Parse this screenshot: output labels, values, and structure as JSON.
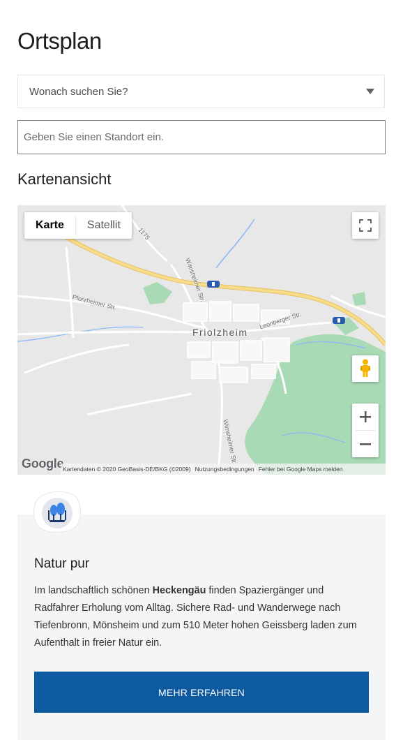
{
  "page": {
    "title": "Ortsplan"
  },
  "filter": {
    "select_value": "Wonach suchen Sie?",
    "location_placeholder": "Geben Sie einen Standort ein."
  },
  "map_section": {
    "title": "Kartenansicht"
  },
  "map": {
    "type_options": [
      "Karte",
      "Satellit"
    ],
    "active_type": "Karte",
    "town": "Friolzheim",
    "street_labels": [
      "Pforzheimer Str.",
      "Wimsheimer Str.",
      "Leonberger Str.",
      "Wimsheimer Str.",
      "1175"
    ],
    "google_logo": "Google",
    "attribution": "Kartendaten © 2020 GeoBasis-DE/BKG (©2009)",
    "terms_link": "Nutzungsbedingungen",
    "report_link": "Fehler bei Google Maps melden",
    "icons": {
      "fullscreen": "fullscreen-icon",
      "pegman": "pegman-icon",
      "zoom_in": "plus-icon",
      "zoom_out": "minus-icon",
      "highway_shield": "highway-shield-icon"
    },
    "colors": {
      "land": "#e8e8e8",
      "forest": "#a8dab5",
      "highway": "#f3d27a",
      "river": "#8ab4f8",
      "road": "#ffffff"
    }
  },
  "info_card": {
    "icon": "trees-icon",
    "title": "Natur pur",
    "text_before": "Im landschaftlich schönen ",
    "text_bold": "Heckengäu",
    "text_after": " finden Spaziergänger und Radfahrer Erholung vom Alltag. Sichere Rad- und Wanderwege nach Tiefenbronn, Mönsheim und zum 510 Meter hohen Geissberg laden zum Aufenthalt in freier Natur ein.",
    "button_label": "MEHR ERFAHREN",
    "accent": "#0d5aa0"
  }
}
